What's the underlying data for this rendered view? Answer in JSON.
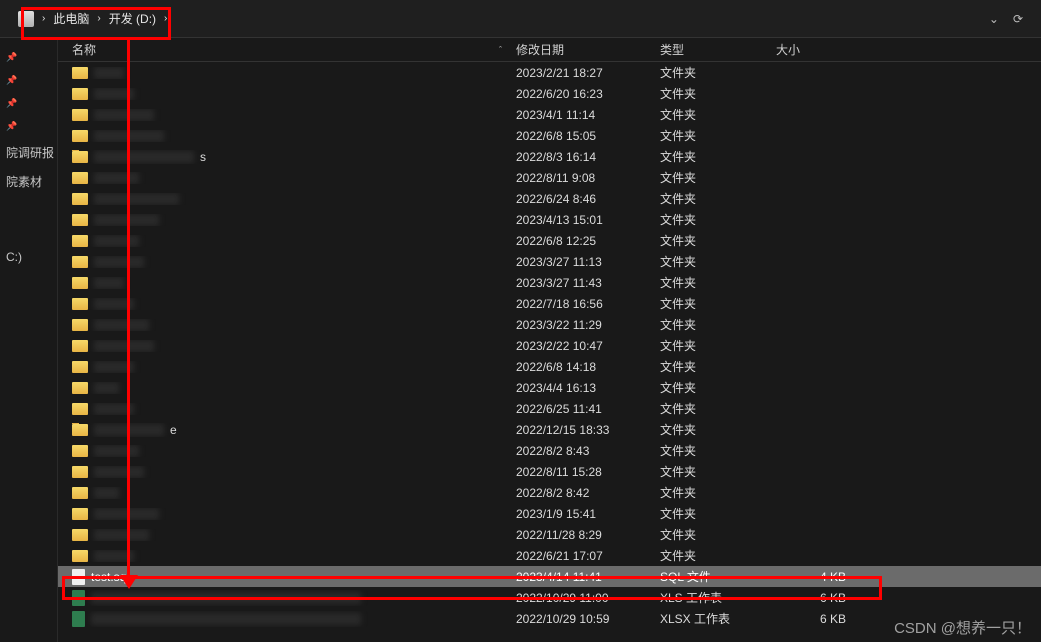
{
  "breadcrumb": {
    "pc": "此电脑",
    "drive": "开发 (D:)"
  },
  "addrIcons": {
    "dropdown": "⌄",
    "refresh": "⟳"
  },
  "columns": {
    "name": "名称",
    "date": "修改日期",
    "type": "类型",
    "size": "大小"
  },
  "sidebar": {
    "items": [
      "",
      "",
      "",
      "",
      "院调研报",
      "院素材",
      "",
      "",
      "",
      "",
      "C:)",
      ""
    ]
  },
  "folderType": "文件夹",
  "rows": [
    {
      "name": "",
      "blurW": 30,
      "date": "2023/2/21 18:27",
      "type": "文件夹",
      "size": "",
      "kind": "folder"
    },
    {
      "name": "",
      "blurW": 40,
      "date": "2022/6/20 16:23",
      "type": "文件夹",
      "size": "",
      "kind": "folder"
    },
    {
      "name": "",
      "blurW": 60,
      "date": "2023/4/1 11:14",
      "type": "文件夹",
      "size": "",
      "kind": "folder"
    },
    {
      "name": "",
      "blurW": 70,
      "date": "2022/6/8 15:05",
      "type": "文件夹",
      "size": "",
      "kind": "folder"
    },
    {
      "name": "s",
      "blurW": 100,
      "date": "2022/8/3 16:14",
      "type": "文件夹",
      "size": "",
      "kind": "folder"
    },
    {
      "name": "",
      "blurW": 45,
      "date": "2022/8/11 9:08",
      "type": "文件夹",
      "size": "",
      "kind": "folder"
    },
    {
      "name": "",
      "blurW": 85,
      "date": "2022/6/24 8:46",
      "type": "文件夹",
      "size": "",
      "kind": "folder"
    },
    {
      "name": "",
      "blurW": 65,
      "date": "2023/4/13 15:01",
      "type": "文件夹",
      "size": "",
      "kind": "folder"
    },
    {
      "name": "",
      "blurW": 45,
      "date": "2022/6/8 12:25",
      "type": "文件夹",
      "size": "",
      "kind": "folder"
    },
    {
      "name": "",
      "blurW": 50,
      "date": "2023/3/27 11:13",
      "type": "文件夹",
      "size": "",
      "kind": "folder"
    },
    {
      "name": "",
      "blurW": 30,
      "date": "2023/3/27 11:43",
      "type": "文件夹",
      "size": "",
      "kind": "folder"
    },
    {
      "name": "",
      "blurW": 40,
      "date": "2022/7/18 16:56",
      "type": "文件夹",
      "size": "",
      "kind": "folder"
    },
    {
      "name": "",
      "blurW": 55,
      "date": "2023/3/22 11:29",
      "type": "文件夹",
      "size": "",
      "kind": "folder"
    },
    {
      "name": "",
      "blurW": 60,
      "date": "2023/2/22 10:47",
      "type": "文件夹",
      "size": "",
      "kind": "folder"
    },
    {
      "name": "",
      "blurW": 40,
      "date": "2022/6/8 14:18",
      "type": "文件夹",
      "size": "",
      "kind": "folder"
    },
    {
      "name": "",
      "blurW": 25,
      "date": "2023/4/4 16:13",
      "type": "文件夹",
      "size": "",
      "kind": "folder"
    },
    {
      "name": "",
      "blurW": 40,
      "date": "2022/6/25 11:41",
      "type": "文件夹",
      "size": "",
      "kind": "folder"
    },
    {
      "name": "e",
      "blurW": 70,
      "date": "2022/12/15 18:33",
      "type": "文件夹",
      "size": "",
      "kind": "folder"
    },
    {
      "name": "",
      "blurW": 45,
      "date": "2022/8/2 8:43",
      "type": "文件夹",
      "size": "",
      "kind": "folder"
    },
    {
      "name": "",
      "blurW": 50,
      "date": "2022/8/11 15:28",
      "type": "文件夹",
      "size": "",
      "kind": "folder"
    },
    {
      "name": "",
      "blurW": 25,
      "date": "2022/8/2 8:42",
      "type": "文件夹",
      "size": "",
      "kind": "folder"
    },
    {
      "name": "",
      "blurW": 65,
      "date": "2023/1/9 15:41",
      "type": "文件夹",
      "size": "",
      "kind": "folder"
    },
    {
      "name": "",
      "blurW": 55,
      "date": "2022/11/28 8:29",
      "type": "文件夹",
      "size": "",
      "kind": "folder"
    },
    {
      "name": "",
      "blurW": 40,
      "date": "2022/6/21 17:07",
      "type": "文件夹",
      "size": "",
      "kind": "folder"
    },
    {
      "name": "test.sql",
      "blurW": 0,
      "date": "2023/4/14 11:41",
      "type": "SQL 文件",
      "size": "4 KB",
      "kind": "file",
      "selected": true
    },
    {
      "name": "",
      "blurW": 270,
      "date": "2022/10/29 11:00",
      "type": "XLS 工作表",
      "size": "6 KB",
      "kind": "xls"
    },
    {
      "name": "",
      "blurW": 270,
      "date": "2022/10/29 10:59",
      "type": "XLSX 工作表",
      "size": "6 KB",
      "kind": "xls"
    }
  ],
  "watermark": "CSDN @想养一只！"
}
